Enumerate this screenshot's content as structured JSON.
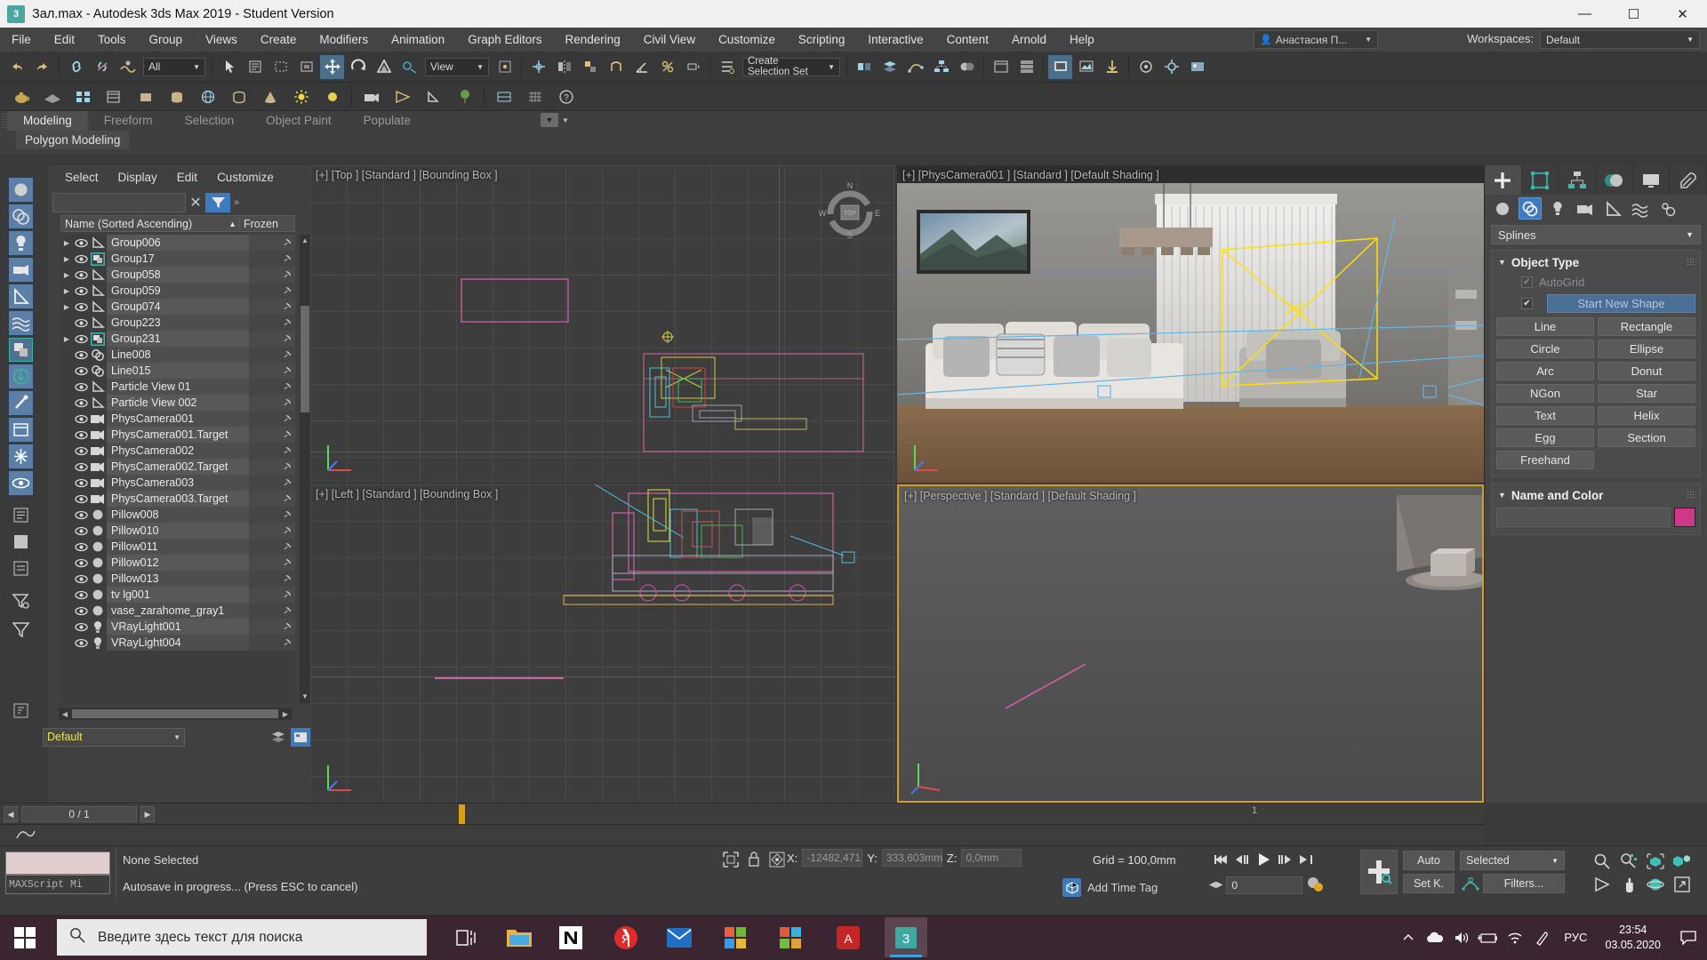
{
  "window": {
    "title": "Зал.max - Autodesk 3ds Max 2019 - Student Version",
    "app_icon": "3dsmax-icon",
    "minimize": "—",
    "maximize": "☐",
    "close": "✕"
  },
  "menu": {
    "items": [
      "File",
      "Edit",
      "Tools",
      "Group",
      "Views",
      "Create",
      "Modifiers",
      "Animation",
      "Graph Editors",
      "Rendering",
      "Civil View",
      "Customize",
      "Scripting",
      "Interactive",
      "Content",
      "Arnold",
      "Help"
    ],
    "user": "Анастасия П...",
    "workspaces_label": "Workspaces:",
    "workspace_value": "Default"
  },
  "toolbar": {
    "selection_filter": "All",
    "reference_coord": "View",
    "selection_set": "Create Selection Set"
  },
  "ribbon": {
    "tabs": [
      "Modeling",
      "Freeform",
      "Selection",
      "Object Paint",
      "Populate"
    ],
    "active_tab": "Modeling",
    "panel_label": "Polygon Modeling"
  },
  "explorer": {
    "menu": [
      "Select",
      "Display",
      "Edit",
      "Customize"
    ],
    "search_value": "",
    "search_placeholder": "",
    "clear_label": "✕",
    "column_name": "Name (Sorted Ascending)",
    "column_frozen": "Frozen",
    "sort_arrow": "▲",
    "rows": [
      {
        "name": "Group006",
        "type": "helper",
        "expandable": true
      },
      {
        "name": "Group17",
        "type": "group",
        "expandable": true
      },
      {
        "name": "Group058",
        "type": "helper",
        "expandable": true
      },
      {
        "name": "Group059",
        "type": "helper",
        "expandable": true
      },
      {
        "name": "Group074",
        "type": "helper",
        "expandable": true
      },
      {
        "name": "Group223",
        "type": "helper",
        "expandable": false
      },
      {
        "name": "Group231",
        "type": "group",
        "expandable": true
      },
      {
        "name": "Line008",
        "type": "shape",
        "expandable": false
      },
      {
        "name": "Line015",
        "type": "shape",
        "expandable": false
      },
      {
        "name": "Particle View 01",
        "type": "helper",
        "expandable": false
      },
      {
        "name": "Particle View 002",
        "type": "helper",
        "expandable": false
      },
      {
        "name": "PhysCamera001",
        "type": "camera",
        "expandable": false
      },
      {
        "name": "PhysCamera001.Target",
        "type": "camera",
        "expandable": false
      },
      {
        "name": "PhysCamera002",
        "type": "camera",
        "expandable": false
      },
      {
        "name": "PhysCamera002.Target",
        "type": "camera",
        "expandable": false
      },
      {
        "name": "PhysCamera003",
        "type": "camera",
        "expandable": false
      },
      {
        "name": "PhysCamera003.Target",
        "type": "camera",
        "expandable": false
      },
      {
        "name": "Pillow008",
        "type": "geom",
        "expandable": false
      },
      {
        "name": "Pillow010",
        "type": "geom",
        "expandable": false
      },
      {
        "name": "Pillow011",
        "type": "geom",
        "expandable": false
      },
      {
        "name": "Pillow012",
        "type": "geom",
        "expandable": false
      },
      {
        "name": "Pillow013",
        "type": "geom",
        "expandable": false
      },
      {
        "name": "tv lg001",
        "type": "geom",
        "expandable": false
      },
      {
        "name": "vase_zarahome_gray1",
        "type": "geom",
        "expandable": false
      },
      {
        "name": "VRayLight001",
        "type": "light",
        "expandable": false
      },
      {
        "name": "VRayLight004",
        "type": "light",
        "expandable": false
      }
    ],
    "layer": "Default"
  },
  "viewports": [
    {
      "label": "[+] [Top ] [Standard ] [Bounding Box ]",
      "active": false,
      "name": "viewport-top"
    },
    {
      "label": "[+] [PhysCamera001 ] [Standard ] [Default Shading ]",
      "active": false,
      "name": "viewport-camera"
    },
    {
      "label": "[+] [Left ] [Standard ] [Bounding Box ]",
      "active": false,
      "name": "viewport-left"
    },
    {
      "label": "[+] [Perspective ] [Standard ] [Default Shading ]",
      "active": true,
      "name": "viewport-perspective"
    }
  ],
  "viewcube": {
    "north": "N",
    "south": "S",
    "west": "W",
    "east": "E",
    "top": "TOP"
  },
  "command_panel": {
    "tabs": [
      "create-tab",
      "modify-tab",
      "hierarchy-tab",
      "motion-tab",
      "display-tab",
      "utilities-tab"
    ],
    "active_tab": "create-tab",
    "categories": [
      "geometry-icon",
      "shapes-icon",
      "lights-icon",
      "cameras-icon",
      "helpers-icon",
      "spacewarps-icon",
      "systems-icon"
    ],
    "active_category": "shapes-icon",
    "dropdown": "Splines",
    "object_type": {
      "title": "Object Type",
      "autogrid_label": "AutoGrid",
      "autogrid_checked": true,
      "start_new_shape_label": "Start New Shape",
      "start_new_shape_checked": true,
      "buttons": [
        "Line",
        "Rectangle",
        "Circle",
        "Ellipse",
        "Arc",
        "Donut",
        "NGon",
        "Star",
        "Text",
        "Helix",
        "Egg",
        "Section",
        "Freehand"
      ]
    },
    "name_and_color": {
      "title": "Name and Color",
      "name_value": "",
      "color": "#cf3787"
    }
  },
  "time_slider": {
    "value": "0 / 1",
    "prev": "◀",
    "next": "▶",
    "end_tick": "1"
  },
  "status_bar": {
    "maxscript_mini_label": "MAXScript Mi",
    "selection_status": "None Selected",
    "prompt": "Autosave in progress... (Press ESC to cancel)",
    "x_label": "X:",
    "x_value": "-12482,471",
    "y_label": "Y:",
    "y_value": "333,603mm",
    "z_label": "Z:",
    "z_value": "0,0mm",
    "grid_text": "Grid = 100,0mm",
    "add_time_tag": "Add Time Tag",
    "auto_key": "Auto",
    "set_key": "Set K.",
    "key_filter_mode": "Selected",
    "filters": "Filters...",
    "frame_value": "0"
  },
  "taskbar": {
    "start_icon": "windows-logo-icon",
    "search_placeholder": "Введите здесь текст для поиска",
    "search_icon": "search-icon",
    "pinned": [
      "task-view-icon",
      "file-explorer-icon",
      "notion-icon",
      "yandex-browser-icon",
      "mail-icon",
      "office-icon",
      "store-icon",
      "acrobat-icon",
      "3dsmax-icon"
    ],
    "active_app": "3dsmax-icon",
    "tray_icons": [
      "chevron-up-icon",
      "onedrive-icon",
      "volume-icon",
      "battery-icon",
      "wifi-icon",
      "pen-icon"
    ],
    "language": "РУС",
    "time": "23:54",
    "date": "03.05.2020",
    "notifications": "notification-icon"
  }
}
